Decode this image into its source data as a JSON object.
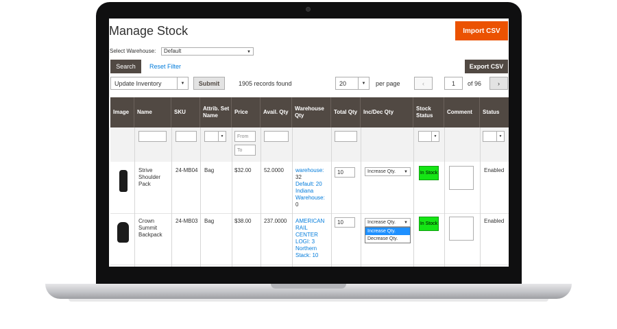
{
  "page": {
    "title": "Manage Stock",
    "import_label": "Import CSV",
    "export_label": "Export CSV"
  },
  "warehouse": {
    "label": "Select Warehouse:",
    "value": "Default"
  },
  "filters": {
    "search_label": "Search",
    "reset_label": "Reset Filter"
  },
  "toolbar": {
    "action_value": "Update Inventory",
    "submit_label": "Submit",
    "records_text": "1905 records found",
    "per_page_value": "20",
    "per_page_label": "per page",
    "page_current": "1",
    "page_total_text": "of 96",
    "prev_icon": "‹",
    "next_icon": "›"
  },
  "grid": {
    "columns": [
      "Image",
      "Name",
      "SKU",
      "Attrib. Set Name",
      "Price",
      "Avail. Qty",
      "Warehouse Qty",
      "Total Qty",
      "Inc/Dec Qty",
      "Stock Status",
      "Comment",
      "Status"
    ],
    "price_from_placeholder": "From",
    "price_to_placeholder": "To",
    "rows": [
      {
        "name": "Strive Shoulder Pack",
        "sku": "24-MB04",
        "attr_set": "Bag",
        "price": "$32.00",
        "avail_qty": "52.0000",
        "warehouse_lines": [
          "warehouse:",
          "32",
          "Default: 20",
          "Indiana",
          "Warehouse:",
          "0"
        ],
        "total_qty": "10",
        "incdec": "Increase Qty.",
        "stock_status": "In Stock",
        "status": "Enabled"
      },
      {
        "name": "Crown Summit Backpack",
        "sku": "24-MB03",
        "attr_set": "Bag",
        "price": "$38.00",
        "avail_qty": "237.0000",
        "warehouse_lines": [
          "AMERICAN",
          "RAIL",
          "CENTER",
          "LOGI: 3",
          "Northern",
          "Stack: 10"
        ],
        "total_qty": "10",
        "incdec": "Increase Qty.",
        "incdec_options": [
          "Increase Qty.",
          "Decrease Qty."
        ],
        "stock_status": "In Stock",
        "status": "Enabled"
      }
    ]
  },
  "colors": {
    "accent": "#eb5202",
    "header_bg": "#514943",
    "link": "#007bdb",
    "in_stock": "#15e515"
  }
}
